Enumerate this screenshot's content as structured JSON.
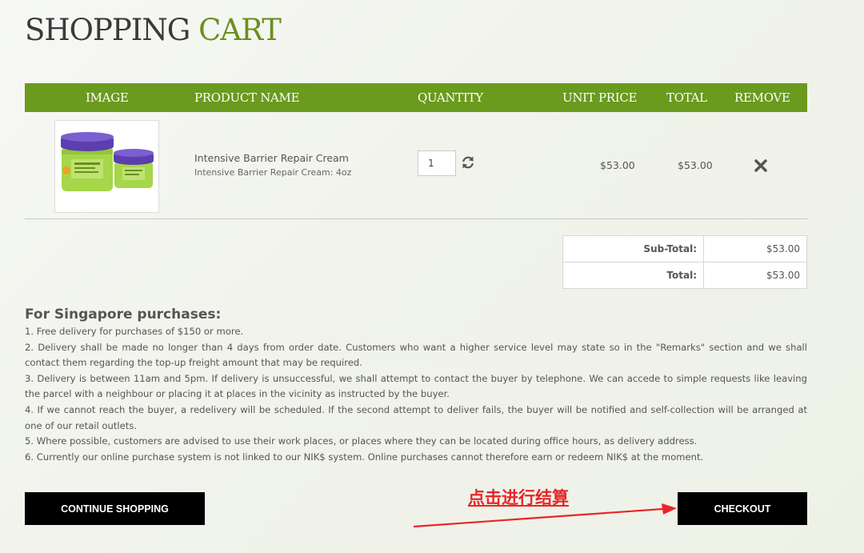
{
  "page": {
    "title_part1": "SHOPPING",
    "title_part2": "CART"
  },
  "table": {
    "headers": [
      "IMAGE",
      "PRODUCT NAME",
      "QUANTITY",
      "UNIT PRICE",
      "TOTAL",
      "REMOVE"
    ],
    "rows": [
      {
        "name": "Intensive Barrier Repair Cream",
        "option": "Intensive Barrier Repair Cream: 4oz",
        "quantity": "1",
        "unit_price": "$53.00",
        "total": "$53.00",
        "icons": {
          "image": "product-jar-image",
          "refresh": "refresh-icon",
          "remove": "close-icon"
        }
      }
    ]
  },
  "totals": [
    {
      "label": "Sub-Total:",
      "value": "$53.00"
    },
    {
      "label": "Total:",
      "value": "$53.00"
    }
  ],
  "notes": {
    "heading": "For Singapore purchases:",
    "items": [
      "1. Free delivery for purchases of $150 or more.",
      "2. Delivery shall be made no longer than 4 days from order date. Customers who want a higher service level may state so in the \"Remarks\" section and we shall contact them regarding the top-up freight amount that may be required.",
      "3. Delivery is between 11am and 5pm. If delivery is unsuccessful, we shall attempt to contact the buyer by telephone. We can accede to simple requests like leaving the parcel with a neighbour or placing it at places in the vicinity as instructed by the buyer.",
      "4. If we cannot reach the buyer, a redelivery will be scheduled. If the second attempt to deliver fails, the buyer will be notified and self-collection will be arranged at one of our retail outlets.",
      "5. Where possible, customers are advised to use their work places, or places where they can be located during office hours, as delivery address.",
      "6. Currently our online purchase system is not linked to our NIK$ system. Online purchases cannot therefore earn or redeem NIK$ at the moment."
    ]
  },
  "buttons": {
    "continue": "CONTINUE SHOPPING",
    "checkout": "CHECKOUT"
  },
  "annotation": {
    "text": "点击进行结算",
    "color": "#e8262a"
  },
  "colors": {
    "accent": "#6a9a1e",
    "title_accent": "#6b8f1f",
    "button": "#000000"
  }
}
